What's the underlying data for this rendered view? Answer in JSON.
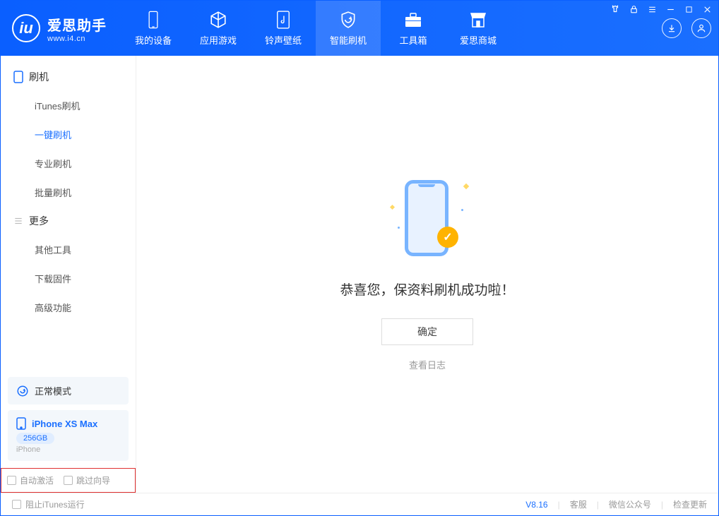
{
  "app": {
    "title": "爱思助手",
    "subtitle": "www.i4.cn"
  },
  "nav": {
    "tabs": [
      {
        "label": "我的设备"
      },
      {
        "label": "应用游戏"
      },
      {
        "label": "铃声壁纸"
      },
      {
        "label": "智能刷机"
      },
      {
        "label": "工具箱"
      },
      {
        "label": "爱思商城"
      }
    ]
  },
  "sidebar": {
    "section1": {
      "title": "刷机"
    },
    "items1": [
      {
        "label": "iTunes刷机"
      },
      {
        "label": "一键刷机"
      },
      {
        "label": "专业刷机"
      },
      {
        "label": "批量刷机"
      }
    ],
    "section2": {
      "title": "更多"
    },
    "items2": [
      {
        "label": "其他工具"
      },
      {
        "label": "下载固件"
      },
      {
        "label": "高级功能"
      }
    ]
  },
  "device": {
    "mode": "正常模式",
    "name": "iPhone XS Max",
    "capacity": "256GB",
    "type": "iPhone"
  },
  "options": {
    "auto_activate": "自动激活",
    "skip_guide": "跳过向导"
  },
  "main": {
    "success_message": "恭喜您，保资料刷机成功啦！",
    "ok_button": "确定",
    "view_log": "查看日志"
  },
  "footer": {
    "block_itunes": "阻止iTunes运行",
    "version": "V8.16",
    "support": "客服",
    "wechat": "微信公众号",
    "check_update": "检查更新"
  }
}
